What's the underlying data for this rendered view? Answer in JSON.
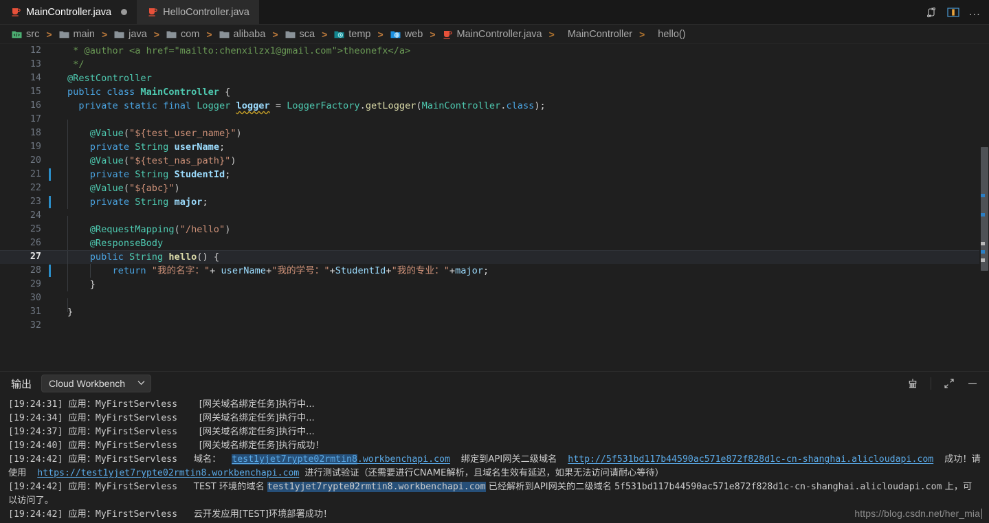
{
  "window": {
    "tabs": [
      {
        "label": "MainController.java",
        "icon": "java-file-icon",
        "active": true,
        "dirty": true
      },
      {
        "label": "HelloController.java",
        "icon": "java-file-icon",
        "active": false,
        "dirty": false
      }
    ],
    "tab_actions": [
      {
        "name": "split-editor-compare-icon",
        "glyph": "compare"
      },
      {
        "name": "split-editor-right-icon",
        "glyph": "split"
      },
      {
        "name": "more-actions-icon",
        "glyph": "..."
      }
    ]
  },
  "breadcrumb": {
    "items": [
      {
        "label": "src",
        "icon": "source-folder-icon"
      },
      {
        "label": "main",
        "icon": "folder-icon"
      },
      {
        "label": "java",
        "icon": "folder-icon"
      },
      {
        "label": "com",
        "icon": "folder-icon"
      },
      {
        "label": "alibaba",
        "icon": "folder-icon"
      },
      {
        "label": "sca",
        "icon": "folder-icon"
      },
      {
        "label": "temp",
        "icon": "temp-folder-icon"
      },
      {
        "label": "web",
        "icon": "web-folder-icon"
      },
      {
        "label": "MainController.java",
        "icon": "java-file-icon"
      },
      {
        "label": "MainController",
        "icon": "none"
      },
      {
        "label": "hello()",
        "icon": "none"
      }
    ],
    "separator": ">"
  },
  "editor": {
    "current_line": 27,
    "first_line": 12,
    "last_line": 32,
    "changed_lines": [
      21,
      23,
      28
    ],
    "lines": [
      {
        "n": 12,
        "text": " * @author <a href=\"mailto:chenxilzx1@gmail.com\">theonefx</a>"
      },
      {
        "n": 13,
        "text": " */"
      },
      {
        "n": 14,
        "text": "@RestController"
      },
      {
        "n": 15,
        "text": "public class MainController {"
      },
      {
        "n": 16,
        "text": "  private static final Logger logger = LoggerFactory.getLogger(MainController.class);"
      },
      {
        "n": 17,
        "text": ""
      },
      {
        "n": 18,
        "text": "    @Value(\"${test_user_name}\")"
      },
      {
        "n": 19,
        "text": "    private String userName;"
      },
      {
        "n": 20,
        "text": "    @Value(\"${test_nas_path}\")"
      },
      {
        "n": 21,
        "text": "    private String StudentId;"
      },
      {
        "n": 22,
        "text": "    @Value(\"${abc}\")"
      },
      {
        "n": 23,
        "text": "    private String major;"
      },
      {
        "n": 24,
        "text": ""
      },
      {
        "n": 25,
        "text": "    @RequestMapping(\"/hello\")"
      },
      {
        "n": 26,
        "text": "    @ResponseBody"
      },
      {
        "n": 27,
        "text": "    public String hello() {"
      },
      {
        "n": 28,
        "text": "        return \"我的名字：\"+ userName+\"我的学号：\"+StudentId+\"我的专业：\"+major;"
      },
      {
        "n": 29,
        "text": "    }"
      },
      {
        "n": 30,
        "text": ""
      },
      {
        "n": 31,
        "text": "}"
      },
      {
        "n": 32,
        "text": ""
      }
    ]
  },
  "output_panel": {
    "title": "输出",
    "channel_selected": "Cloud Workbench",
    "chevron": "⌄",
    "actions": [
      {
        "name": "clear-output-icon",
        "glyph": "broom"
      },
      {
        "name": "maximize-panel-icon",
        "glyph": "expand"
      },
      {
        "name": "hide-panel-icon",
        "glyph": "minus"
      }
    ],
    "log_lines": [
      {
        "time": "[19:24:31]",
        "app_label": "应用：",
        "app": "MyFirstServless",
        "msg": "[网关域名绑定任务]执行中..."
      },
      {
        "time": "[19:24:34]",
        "app_label": "应用：",
        "app": "MyFirstServless",
        "msg": "[网关域名绑定任务]执行中..."
      },
      {
        "time": "[19:24:37]",
        "app_label": "应用：",
        "app": "MyFirstServless",
        "msg": "[网关域名绑定任务]执行中..."
      },
      {
        "time": "[19:24:40]",
        "app_label": "应用：",
        "app": "MyFirstServless",
        "msg": "[网关域名绑定任务]执行成功！"
      }
    ],
    "domain_entry": {
      "time": "[19:24:42]",
      "app_label": "应用：",
      "app": "MyFirstServless",
      "label": "域名：",
      "url1": "https://test1yjet7rypte02rmtin8.workbenchapi.com",
      "url1_selected_part": "test1yjet7rypte02rmtin8",
      "mid1": "绑定到API网关二级域名",
      "url2": "http://5f531bd117b44590ac571e872f828d1c-cn-shanghai.alicloudapi.com",
      "mid2": "成功！请使用",
      "url3": "https://test1yjet7rypte02rmtin8.workbenchapi.com",
      "tail": "进行测试验证（还需要进行CNAME解析，且域名生效有延迟，如果无法访问请耐心等待）"
    },
    "resolve_entry": {
      "time": "[19:24:42]",
      "app_label": "应用：",
      "app": "MyFirstServless",
      "pre": "TEST 环境的域名 ",
      "host": "test1yjet7rypte02rmtin8.workbenchapi.com",
      "mid": " 已经解析到API网关的二级域名 ",
      "target": "5f531bd117b44590ac571e872f828d1c-cn-shanghai.alicloudapi.com",
      "tail": " 上，可以访问了。"
    },
    "final_entry": {
      "time": "[19:24:42]",
      "app_label": "应用：",
      "app": "MyFirstServless",
      "msg": "云开发应用[TEST]环境部署成功！"
    }
  },
  "watermark": {
    "text": "https://blog.csdn.net/her_mia"
  },
  "colors": {
    "background": "#1f1f1f",
    "tabbar": "#181818",
    "inactive_tab": "#2b2b2b",
    "accent_link": "#5aa9e6",
    "selection": "#264f78",
    "gutter_change": "#2b8dc7",
    "breadcrumb_sep": "#c07c3c"
  }
}
